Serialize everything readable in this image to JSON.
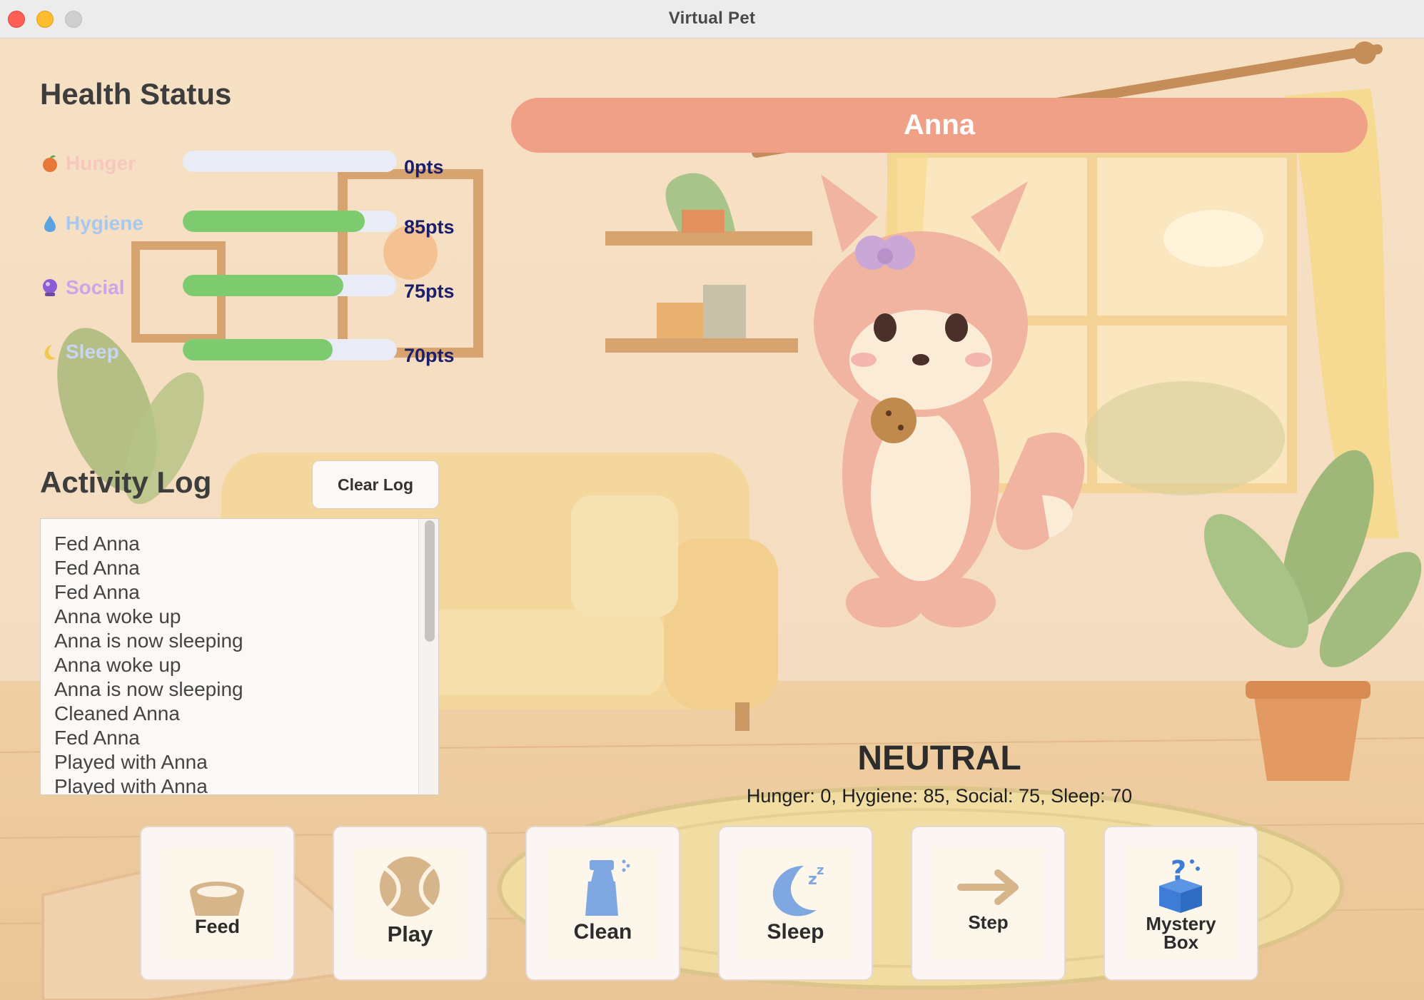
{
  "window": {
    "title": "Virtual Pet"
  },
  "health": {
    "title": "Health Status",
    "stats": [
      {
        "name": "Hunger",
        "value_label": "0pts",
        "value": 0,
        "icon": "peach-icon",
        "color": "#f6c7bf"
      },
      {
        "name": "Hygiene",
        "value_label": "85pts",
        "value": 85,
        "icon": "water-drop-icon",
        "color": "#a7c9ef"
      },
      {
        "name": "Social",
        "value_label": "75pts",
        "value": 75,
        "icon": "crystal-ball-icon",
        "color": "#caa6e8"
      },
      {
        "name": "Sleep",
        "value_label": "70pts",
        "value": 70,
        "icon": "crescent-moon-icon",
        "color": "#c7d6f3"
      }
    ],
    "bar_fill_color": "#7dca6f",
    "bar_track_color": "#e9ebf7"
  },
  "pet": {
    "name": "Anna",
    "mood": "NEUTRAL",
    "stats_line": "Hunger: 0, Hygiene: 85, Social: 75, Sleep: 70"
  },
  "log": {
    "title": "Activity Log",
    "clear_label": "Clear Log",
    "entries": [
      "Fed Anna",
      "Fed Anna",
      "Fed Anna",
      "Anna woke up",
      "Anna is now sleeping",
      "Anna woke up",
      "Anna is now sleeping",
      "Cleaned Anna",
      "Fed Anna",
      "Played with Anna",
      "Played with Anna"
    ]
  },
  "actions": {
    "feed": "Feed",
    "play": "Play",
    "clean": "Clean",
    "sleep": "Sleep",
    "step": "Step",
    "mystery_line1": "Mystery",
    "mystery_line2": "Box"
  },
  "colors": {
    "name_banner": "#f1a088",
    "value_text": "#1b1f6b"
  }
}
